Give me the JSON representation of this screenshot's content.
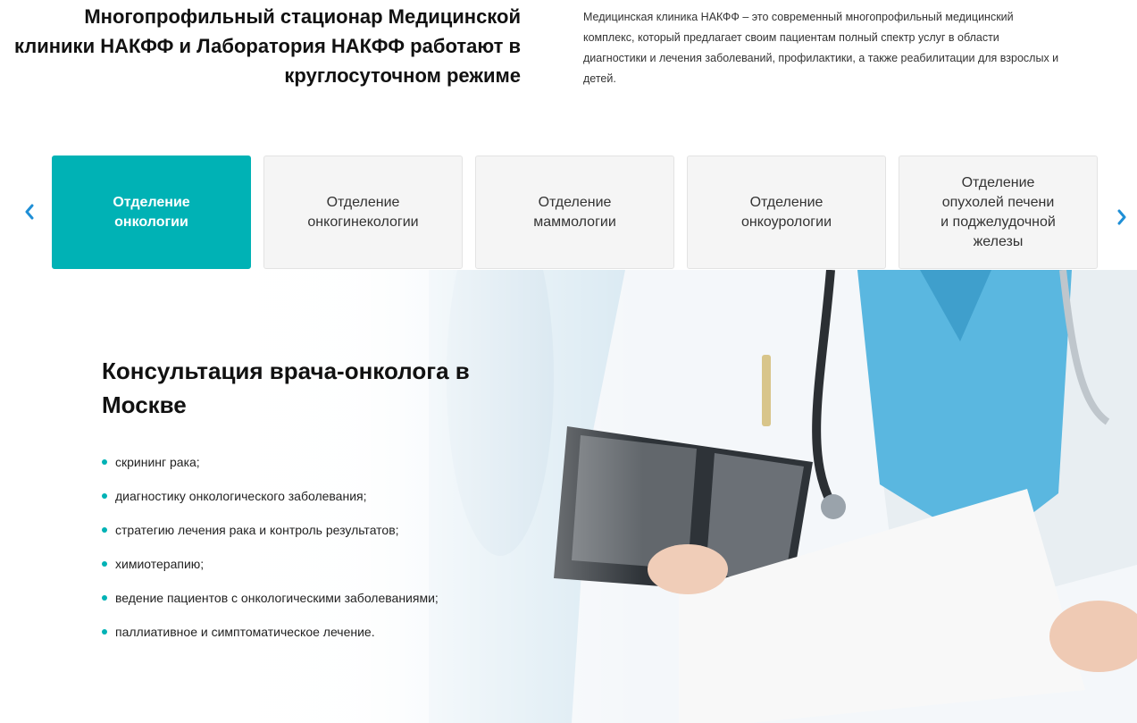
{
  "header": {
    "title": "Многопрофильный стационар Медицинской клиники НАКФФ и Лаборатория НАКФФ работают в круглосуточном режиме",
    "description": "Медицинская клиника НАКФФ – это современный многопрофильный медицинский комплекс, который предлагает своим пациентам полный спектр услуг в области диагностики и лечения заболеваний, профилактики, а также реабилитации для взрослых и детей."
  },
  "tabs": [
    {
      "label": "Отделение\nонкологии",
      "active": true
    },
    {
      "label": "Отделение\nонкогинекологии",
      "active": false
    },
    {
      "label": "Отделение\nмаммологии",
      "active": false
    },
    {
      "label": "Отделение\nонкоурологии",
      "active": false
    },
    {
      "label": "Отделение\nопухолей печени\nи поджелудочной\nжелезы",
      "active": false
    }
  ],
  "hero": {
    "title": "Консультация врача-онколога в Москве",
    "items": [
      "скрининг рака;",
      "диагностику онкологического заболевания;",
      "стратегию лечения рака и контроль результатов;",
      "химиотерапию;",
      "ведение пациентов с онкологическими заболеваниями;",
      "паллиативное и симптоматическое лечение."
    ]
  },
  "colors": {
    "accent": "#00b2b5",
    "arrow": "#1f8fd6",
    "scrubs": "#5ab7e0"
  }
}
